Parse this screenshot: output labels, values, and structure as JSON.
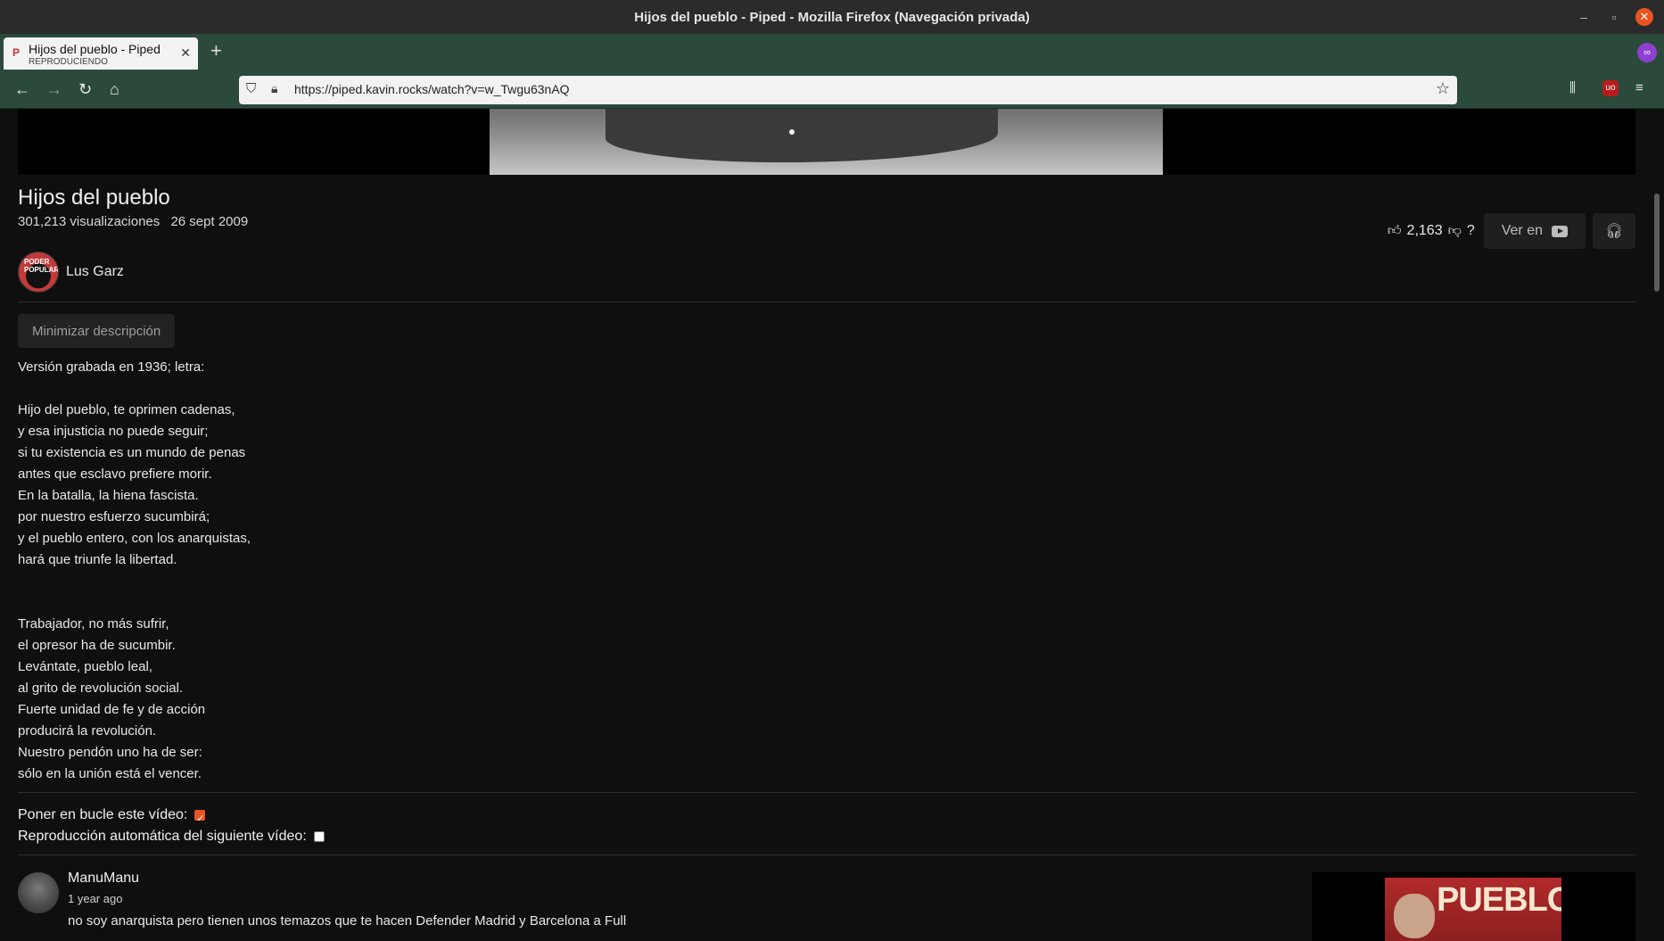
{
  "window": {
    "title": "Hijos del pueblo - Piped - Mozilla Firefox (Navegación privada)"
  },
  "tab": {
    "title": "Hijos del pueblo - Piped",
    "subtitle": "REPRODUCIENDO",
    "favicon": "P"
  },
  "navbar": {
    "url": "https://piped.kavin.rocks/watch?v=w_Twgu63nAQ"
  },
  "video": {
    "title": "Hijos del pueblo",
    "views": "301,213 visualizaciones",
    "date": "26 sept 2009",
    "likes": "2,163",
    "dislikes": "?",
    "watch_on_label": "Ver en"
  },
  "channel": {
    "name": "Lus Garz",
    "avatar_text": "PODER POPULAR"
  },
  "description": {
    "toggle_label": "Minimizar descripción",
    "intro": "Versión grabada en 1936; letra:",
    "verse1": [
      "Hijo del pueblo, te oprimen cadenas,",
      "y esa injusticia no puede seguir;",
      "si tu existencia es un mundo de penas",
      "antes que esclavo prefiere morir.",
      "En la batalla, la hiena fascista.",
      "por nuestro esfuerzo sucumbirá;",
      "y el pueblo entero, con los anarquistas,",
      "hará que triunfe la libertad."
    ],
    "verse2": [
      "Trabajador, no más sufrir,",
      "el opresor ha de sucumbir.",
      "Levántate, pueblo leal,",
      "al grito de revolución social.",
      "Fuerte unidad de fe y de acción",
      "producirá la revolución.",
      "Nuestro pendón uno ha de ser:",
      "sólo en la unión está el vencer."
    ]
  },
  "options": {
    "loop_label": "Poner en bucle este vídeo:",
    "loop_checked": true,
    "autoplay_label": "Reproducción automática del siguiente vídeo:",
    "autoplay_checked": false
  },
  "comment": {
    "author": "ManuManu",
    "time": "1 year ago",
    "text": "no soy anarquista pero tienen unos temazos   que te hacen Defender Madrid y Barcelona  a Full"
  },
  "related": {
    "thumb_text": "PUEBLO"
  },
  "colors": {
    "accent": "#e95420",
    "toolbar": "#2c4a3c",
    "background": "#0f0f0f"
  }
}
